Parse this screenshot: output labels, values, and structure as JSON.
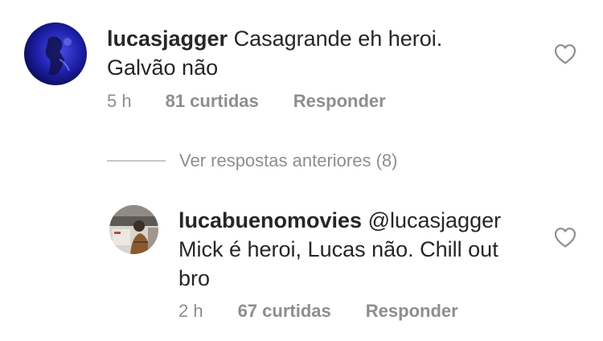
{
  "comments": [
    {
      "username": "lucasjagger",
      "text_line1": "Casagrande eh heroi.",
      "text_line2": "Galvão não",
      "time": "5 h",
      "likes": "81 curtidas",
      "reply": "Responder"
    },
    {
      "username": "lucabuenomovies",
      "mention": "@lucasjagger",
      "text_line1": "Mick é heroi, Lucas não. Chill out",
      "text_line2": "bro",
      "time": "2 h",
      "likes": "67 curtidas",
      "reply": "Responder"
    }
  ],
  "view_previous": "Ver respostas anteriores (8)",
  "icons": {
    "like": "heart-outline-icon"
  },
  "colors": {
    "text": "#262626",
    "muted": "#8e8e8e",
    "line": "#c7c7c7"
  }
}
